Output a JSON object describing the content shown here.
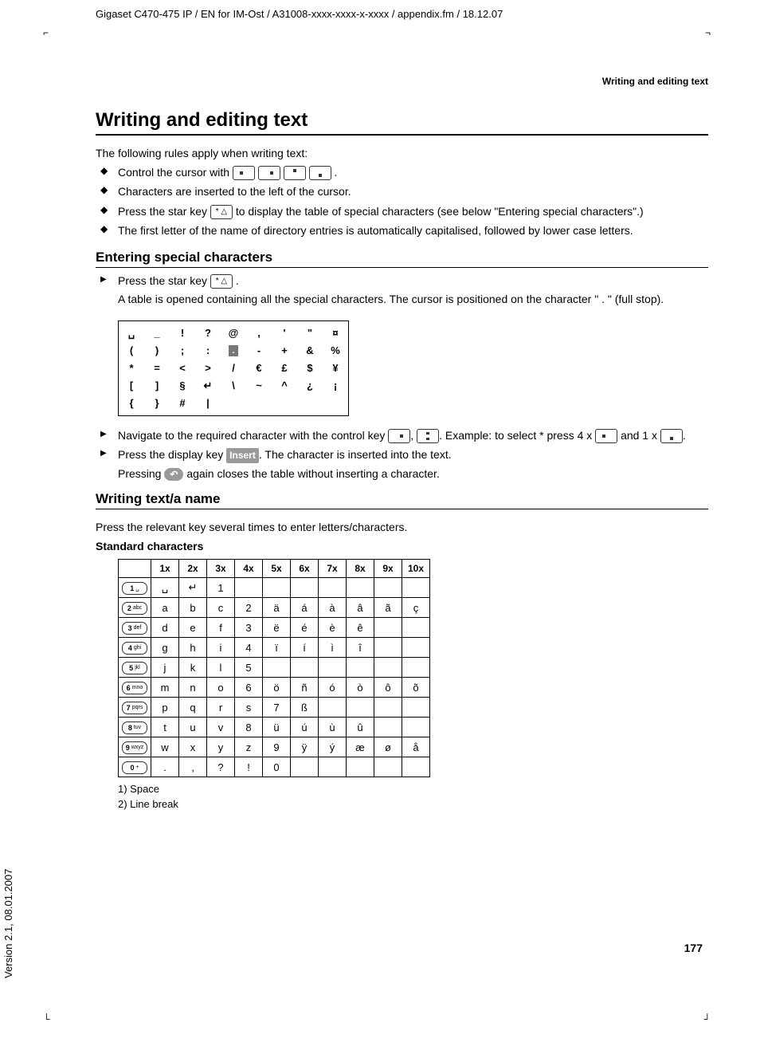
{
  "header_path": "Gigaset C470-475 IP / EN for IM-Ost / A31008-xxxx-xxxx-x-xxxx / appendix.fm / 18.12.07",
  "running_header": "Writing and editing text",
  "section_title": "Writing and editing text",
  "intro": "The following rules apply when writing text:",
  "bullets": {
    "b1a": "Control the cursor with ",
    "b1b": ".",
    "b2": "Characters are inserted to the left of the cursor.",
    "b3a": "Press the star key ",
    "b3b": " to display the table of special characters (see below \"Entering special characters\".)",
    "b4": "The first letter of the name of directory entries is automatically capitalised, followed by lower case letters."
  },
  "entering_heading": "Entering special characters",
  "entering": {
    "step1a": "Press the star key ",
    "step1b": ".",
    "step1c": "A table is opened containing all the special characters. The cursor is positioned on the character \" . \" (full stop).",
    "step2a": "Navigate to the required character with the control key ",
    "step2b": ", ",
    "step2c": ". Example: to select * press 4 x ",
    "step2d": " and 1 x ",
    "step2e": ".",
    "step3a": "Press the display key ",
    "step3b": ". The character is inserted into the text.",
    "step3c": "Pressing ",
    "step3d": " again closes the table without inserting a character."
  },
  "softkeys": {
    "insert": "Insert",
    "back": "↶",
    "star": "* △"
  },
  "special_table": [
    [
      "␣",
      "_",
      "!",
      "?",
      "@",
      ",",
      "'",
      "\"",
      "¤"
    ],
    [
      "(",
      ")",
      ";",
      ":",
      ".",
      "-",
      "+",
      "&",
      "%"
    ],
    [
      "*",
      "=",
      "<",
      ">",
      "/",
      "€",
      "£",
      "$",
      "¥"
    ],
    [
      "[",
      "]",
      "§",
      "↵",
      "\\",
      "~",
      "^",
      "¿",
      "¡"
    ],
    [
      "{",
      "}",
      "#",
      "|",
      "",
      "",
      "",
      "",
      ""
    ]
  ],
  "cursor_cell": {
    "row": 1,
    "col": 4
  },
  "writing_heading": "Writing text/a name",
  "writing_intro": "Press the relevant key several times to enter letters/characters.",
  "std_heading": "Standard characters",
  "char_headers": [
    "1x",
    "2x",
    "3x",
    "4x",
    "5x",
    "6x",
    "7x",
    "8x",
    "9x",
    "10x"
  ],
  "char_keys": [
    {
      "num": "1",
      "sub": "␣"
    },
    {
      "num": "2",
      "sub": "abc"
    },
    {
      "num": "3",
      "sub": "def"
    },
    {
      "num": "4",
      "sub": "ghi"
    },
    {
      "num": "5",
      "sub": "jkl"
    },
    {
      "num": "6",
      "sub": "mno"
    },
    {
      "num": "7",
      "sub": "pqrs"
    },
    {
      "num": "8",
      "sub": "tuv"
    },
    {
      "num": "9",
      "sub": "wxyz"
    },
    {
      "num": "0",
      "sub": "+"
    }
  ],
  "char_rows": [
    [
      "␣",
      "↵",
      "1",
      "",
      "",
      "",
      "",
      "",
      "",
      ""
    ],
    [
      "a",
      "b",
      "c",
      "2",
      "ä",
      "á",
      "à",
      "â",
      "ã",
      "ç"
    ],
    [
      "d",
      "e",
      "f",
      "3",
      "ë",
      "é",
      "è",
      "ê",
      "",
      ""
    ],
    [
      "g",
      "h",
      "i",
      "4",
      "ï",
      "í",
      "ì",
      "î",
      "",
      ""
    ],
    [
      "j",
      "k",
      "l",
      "5",
      "",
      "",
      "",
      "",
      "",
      ""
    ],
    [
      "m",
      "n",
      "o",
      "6",
      "ö",
      "ñ",
      "ó",
      "ò",
      "ô",
      "õ"
    ],
    [
      "p",
      "q",
      "r",
      "s",
      "7",
      "ß",
      "",
      "",
      "",
      ""
    ],
    [
      "t",
      "u",
      "v",
      "8",
      "ü",
      "ú",
      "ù",
      "û",
      "",
      ""
    ],
    [
      "w",
      "x",
      "y",
      "z",
      "9",
      "ÿ",
      "ý",
      "æ",
      "ø",
      "å"
    ],
    [
      ".",
      ",",
      "?",
      "!",
      "0",
      "",
      "",
      "",
      "",
      ""
    ]
  ],
  "footnotes": {
    "f1": "1)   Space",
    "f2": "2)   Line break"
  },
  "page_number": "177",
  "side_version": "Version 2.1, 08.01.2007"
}
